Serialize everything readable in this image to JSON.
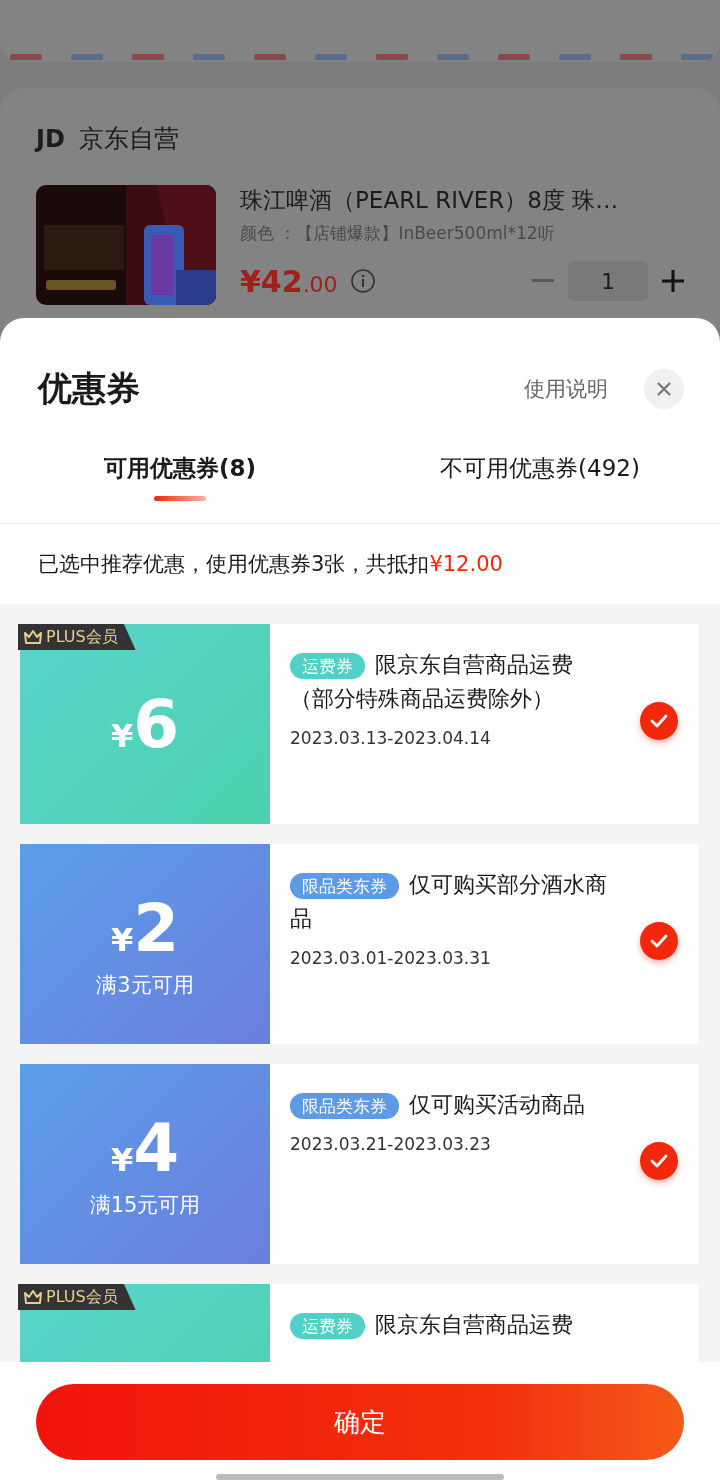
{
  "store": {
    "logo": "JD",
    "name": "京东自营"
  },
  "product": {
    "title": "珠江啤酒（PEARL RIVER）8度 珠…",
    "spec": "颜色 ：【店铺爆款】InBeer500ml*12听",
    "price_integer": "¥42",
    "price_decimal": ".00",
    "quantity": "1"
  },
  "sheet": {
    "title": "优惠券",
    "help": "使用说明"
  },
  "tabs": [
    {
      "label": "可用优惠券(8)",
      "selected": true
    },
    {
      "label": "不可用优惠券(492)",
      "selected": false
    }
  ],
  "summary": {
    "text": "已选中推荐优惠，使用优惠券3张，共抵扣",
    "amount": "¥12.00"
  },
  "coupons": [
    {
      "kind": "freight",
      "plus": true,
      "badge": "PLUS会员",
      "currency": "¥",
      "amount": "6",
      "tag": "运费券",
      "title": "限京东自营商品运费（部分特殊商品运费除外）",
      "dates": "2023.03.13-2023.04.14",
      "checked": true
    },
    {
      "kind": "category",
      "plus": false,
      "currency": "¥",
      "amount": "2",
      "condition": "满3元可用",
      "tag": "限品类东券",
      "title": "仅可购买部分酒水商品",
      "dates": "2023.03.01-2023.03.31",
      "checked": true
    },
    {
      "kind": "category",
      "plus": false,
      "currency": "¥",
      "amount": "4",
      "condition": "满15元可用",
      "tag": "限品类东券",
      "title": "仅可购买活动商品",
      "dates": "2023.03.21-2023.03.23",
      "checked": true
    },
    {
      "kind": "freight",
      "plus": true,
      "badge": "PLUS会员",
      "tag": "运费券",
      "title": "限京东自营商品运费"
    }
  ],
  "confirm": {
    "label": "确定"
  }
}
